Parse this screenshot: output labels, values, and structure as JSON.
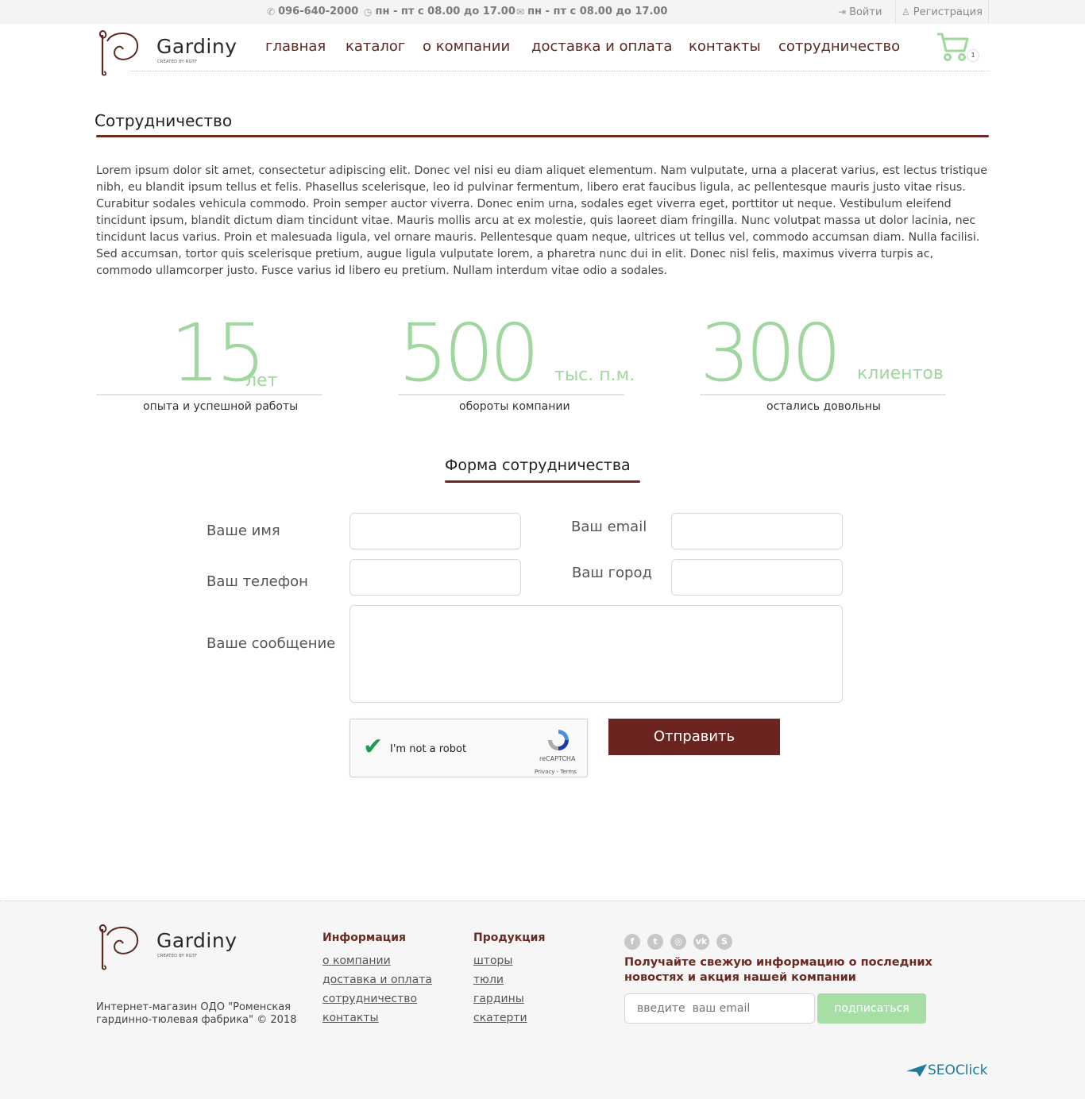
{
  "topbar": {
    "phone": "096-640-2000",
    "hours": "пн - пт с 08.00 до 17.00",
    "email_hours": "пн - пт с 08.00 до 17.00",
    "login": "Войти",
    "register": "Регистрация"
  },
  "brand": {
    "name": "Gardiny",
    "sub": "CREATED BY RGTF"
  },
  "nav": [
    "главная",
    "каталог",
    "о компании",
    "доставка и оплата",
    "контакты",
    "сотрудничество"
  ],
  "cart": {
    "count": "1"
  },
  "page": {
    "title": "Сотрудничество",
    "text": "Lorem ipsum dolor sit amet, consectetur adipiscing elit. Donec vel nisi eu diam aliquet elementum. Nam vulputate, urna a placerat varius, est lectus tristique nibh, eu blandit ipsum tellus et felis. Phasellus scelerisque, leo id pulvinar fermentum, libero erat faucibus ligula, ac pellentesque mauris justo vitae risus. Curabitur sodales vehicula commodo. Proin semper auctor viverra. Donec enim urna, sodales eget viverra eget, porttitor ut neque. Vestibulum eleifend tincidunt ipsum, blandit dictum diam tincidunt vitae. Mauris mollis arcu at ex molestie, quis laoreet diam fringilla. Nunc volutpat massa ut dolor lacinia, nec tincidunt lacus varius. Proin et malesuada ligula, vel ornare mauris. Pellentesque quam neque, ultrices ut tellus vel, commodo accumsan diam. Nulla facilisi. Sed accumsan, tortor quis scelerisque pretium, augue ligula vulputate lorem, a pharetra nunc dui in elit. Donec nisl felis, maximus viverra turpis ac, commodo ullamcorper justo. Fusce varius id libero eu pretium. Nullam interdum vitae odio a sodales."
  },
  "stats": [
    {
      "number": "15",
      "unit": "лет",
      "caption": "опыта и успешной работы"
    },
    {
      "number": "500",
      "unit": "тыс. п.м.",
      "caption": "обороты компании"
    },
    {
      "number": "300",
      "unit": "клиентов",
      "caption": "остались довольны"
    }
  ],
  "form": {
    "title": "Форма сотрудничества",
    "name_label": "Ваше имя",
    "email_label": "Ваш email",
    "phone_label": "Ваш телефон",
    "city_label": "Ваш город",
    "message_label": "Ваше сообщение",
    "captcha_text": "I'm not a robot",
    "captcha_brand": "reCAPTCHA",
    "captcha_links": "Privacy - Terms",
    "submit": "Отправить"
  },
  "footer": {
    "description": "Интернет-магазин ОДО \"Роменская гардинно-тюлевая фабрика\" © 2018",
    "info_title": "Информация",
    "info_links": [
      "о компании",
      "доставка и оплата",
      "сотрудничество",
      "контакты"
    ],
    "products_title": "Продукция",
    "products_links": [
      "шторы",
      "тюли",
      "гардины",
      "скатерти"
    ],
    "newsletter_text": "Получайте свежую информацию о последних новостях и акция нашей компании",
    "email_placeholder": "введите  ваш email",
    "subscribe": "подписаться",
    "credit": "SEOClick"
  },
  "colors": {
    "accent": "#6b2a22",
    "green": "#9fd79f",
    "button": "#6b2420"
  }
}
